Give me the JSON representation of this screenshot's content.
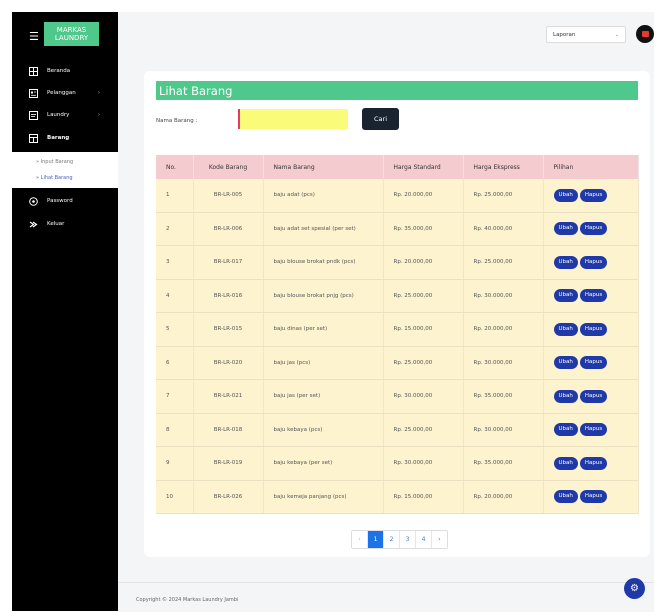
{
  "brand": {
    "line1": "MARKAS",
    "line2": "LAUNDRY"
  },
  "sidebar": {
    "items": [
      {
        "label": "Beranda",
        "icon": "home-grid-icon"
      },
      {
        "label": "Pelanggan",
        "icon": "customer-card-icon"
      },
      {
        "label": "Laundry",
        "icon": "laundry-list-icon"
      },
      {
        "label": "Barang",
        "icon": "items-table-icon"
      },
      {
        "label": "Password",
        "icon": "password-gear-icon"
      },
      {
        "label": "Keluar",
        "icon": "logout-icon"
      }
    ],
    "submenu": [
      "Input Barang",
      "Lihat Barang"
    ]
  },
  "topbar": {
    "report_select": "Laporan"
  },
  "page": {
    "title": "Lihat Barang",
    "search_label": "Nama Barang :",
    "search_value": "",
    "search_button": "Cari"
  },
  "table": {
    "headers": [
      "No.",
      "Kode Barang",
      "Nama Barang",
      "Harga Standard",
      "Harga Ekspress",
      "Pilihan"
    ],
    "action_edit": "Ubah",
    "action_delete": "Hapus",
    "rows": [
      {
        "no": "1",
        "kode": "BR-LR-005",
        "nama": "baju adat (pcs)",
        "standard": "Rp. 20.000,00",
        "ekspress": "Rp. 25.000,00"
      },
      {
        "no": "2",
        "kode": "BR-LR-006",
        "nama": "baju adat set spesial (per set)",
        "standard": "Rp. 35.000,00",
        "ekspress": "Rp. 40.000,00"
      },
      {
        "no": "3",
        "kode": "BR-LR-017",
        "nama": "baju blouse brokat pndk (pcs)",
        "standard": "Rp. 20.000,00",
        "ekspress": "Rp. 25.000,00"
      },
      {
        "no": "4",
        "kode": "BR-LR-016",
        "nama": "baju blouse brokat pnjg (pcs)",
        "standard": "Rp. 25.000,00",
        "ekspress": "Rp. 30.000,00"
      },
      {
        "no": "5",
        "kode": "BR-LR-015",
        "nama": "baju dinas (per set)",
        "standard": "Rp. 15.000,00",
        "ekspress": "Rp. 20.000,00"
      },
      {
        "no": "6",
        "kode": "BR-LR-020",
        "nama": "baju jas (pcs)",
        "standard": "Rp. 25.000,00",
        "ekspress": "Rp. 30.000,00"
      },
      {
        "no": "7",
        "kode": "BR-LR-021",
        "nama": "baju jas (per set)",
        "standard": "Rp. 30.000,00",
        "ekspress": "Rp. 35.000,00"
      },
      {
        "no": "8",
        "kode": "BR-LR-018",
        "nama": "baju kebaya (pcs)",
        "standard": "Rp. 25.000,00",
        "ekspress": "Rp. 30.000,00"
      },
      {
        "no": "9",
        "kode": "BR-LR-019",
        "nama": "baju kebaya (per set)",
        "standard": "Rp. 30.000,00",
        "ekspress": "Rp. 35.000,00"
      },
      {
        "no": "10",
        "kode": "BR-LR-026",
        "nama": "baju kemeja panjang (pcs)",
        "standard": "Rp. 15.000,00",
        "ekspress": "Rp. 20.000,00"
      }
    ]
  },
  "pagination": {
    "prev": "‹",
    "pages": [
      "1",
      "2",
      "3",
      "4"
    ],
    "next": "›"
  },
  "footer": {
    "copyright": "Copyright © 2024 Markas Laundry Jambi"
  },
  "colors": {
    "accent": "#4fc98b",
    "primary": "#1f3aa8",
    "header_row": "#f4ccd0",
    "body_row": "#fdf3cf",
    "search_bg": "#fbfb7a"
  }
}
